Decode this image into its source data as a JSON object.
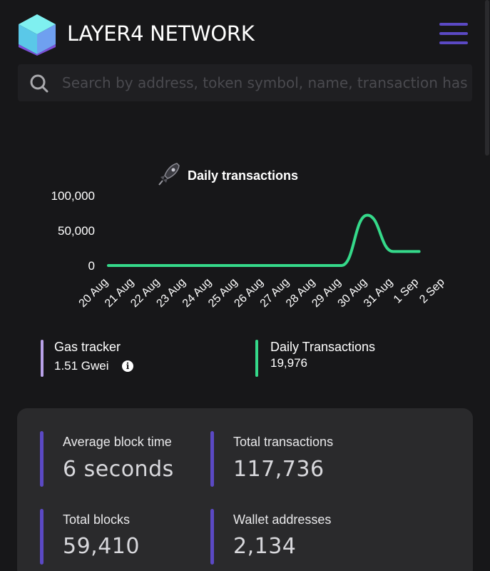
{
  "header": {
    "brand": "LAYER4 NETWORK",
    "logo_icon": "cube-logo-icon",
    "menu_icon": "hamburger-menu-icon"
  },
  "search": {
    "icon": "search-icon",
    "placeholder": "Search by address, token symbol, name, transaction hash"
  },
  "chart_data": {
    "type": "line",
    "title": "Daily transactions",
    "title_icon": "rocket-icon",
    "categories": [
      "20 Aug",
      "21 Aug",
      "22 Aug",
      "23 Aug",
      "24 Aug",
      "25 Aug",
      "26 Aug",
      "27 Aug",
      "28 Aug",
      "29 Aug",
      "30 Aug",
      "31 Aug",
      "1 Sep",
      "2 Sep"
    ],
    "y_ticks": [
      "100,000",
      "50,000",
      "0"
    ],
    "ylim": [
      0,
      100000
    ],
    "series": [
      {
        "values": [
          0,
          0,
          0,
          0,
          0,
          0,
          0,
          0,
          0,
          0,
          72000,
          20000,
          19976
        ],
        "color": "#35d98a"
      }
    ],
    "grid": false
  },
  "stats": {
    "gas_tracker": {
      "label": "Gas tracker",
      "value": "1.51 Gwei",
      "color": "#b9a2e8",
      "icon": "info-icon"
    },
    "daily_transactions": {
      "label": "Daily Transactions",
      "value": "19,976",
      "color": "#35d98a"
    }
  },
  "summary": {
    "average_block_time": {
      "label": "Average block time",
      "value": "6 seconds"
    },
    "total_transactions": {
      "label": "Total transactions",
      "value": "117,736"
    },
    "total_blocks": {
      "label": "Total blocks",
      "value": "59,410"
    },
    "wallet_addresses": {
      "label": "Wallet addresses",
      "value": "2,134"
    },
    "accent_color": "#5b49c4"
  }
}
